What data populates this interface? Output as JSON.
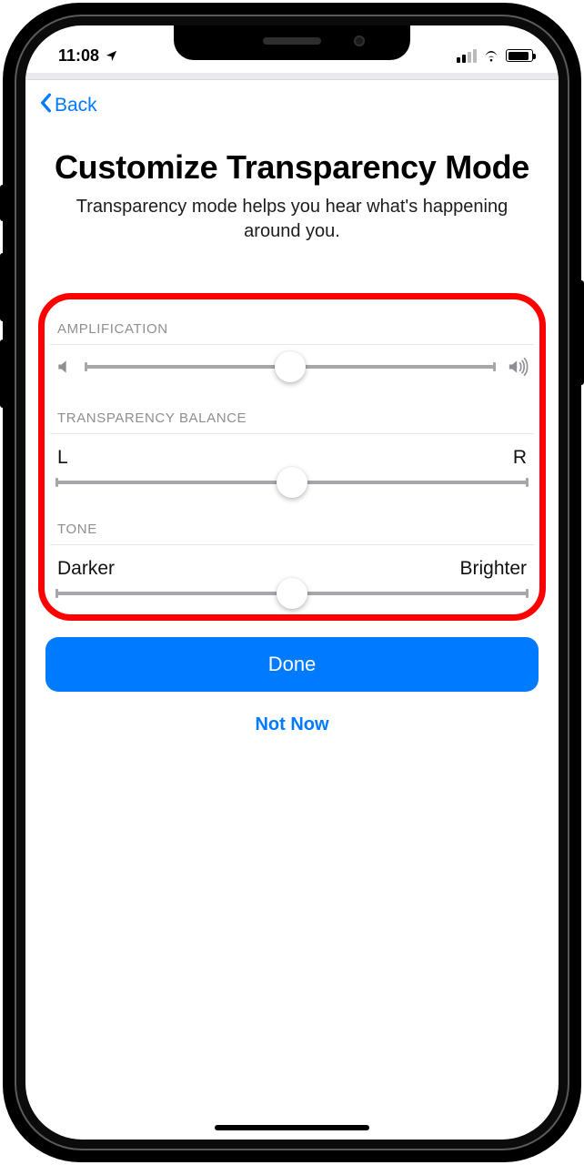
{
  "status": {
    "time": "11:08",
    "location_icon": "location-arrow-icon",
    "signal_bars_active": 2,
    "signal_bars_total": 4,
    "wifi": true,
    "battery_level": 0.85
  },
  "nav": {
    "back_label": "Back"
  },
  "header": {
    "title": "Customize Transparency Mode",
    "subtitle": "Transparency mode helps you hear what's happening around you."
  },
  "sections": {
    "amplification": {
      "label": "AMPLIFICATION",
      "value": 0.5,
      "min_icon": "volume-low-icon",
      "max_icon": "volume-high-icon"
    },
    "balance": {
      "label": "TRANSPARENCY BALANCE",
      "left_label": "L",
      "right_label": "R",
      "value": 0.5
    },
    "tone": {
      "label": "TONE",
      "left_label": "Darker",
      "right_label": "Brighter",
      "value": 0.5
    }
  },
  "footer": {
    "primary": "Done",
    "secondary": "Not Now"
  },
  "colors": {
    "accent": "#007aff",
    "highlight_border": "#ff0000",
    "secondary_text": "#8e8e93"
  }
}
